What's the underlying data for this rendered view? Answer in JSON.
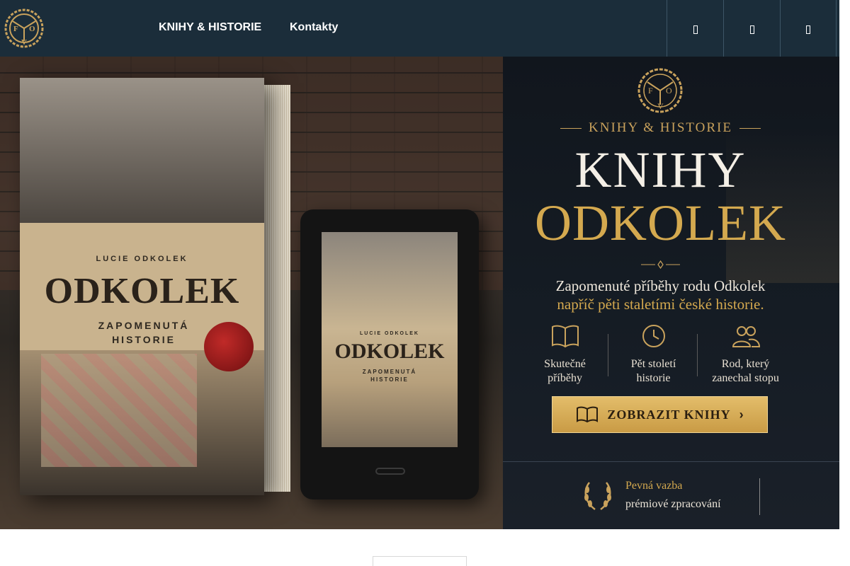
{
  "nav": {
    "logo_letters": [
      "F",
      "O",
      "V"
    ],
    "links": [
      {
        "label": "KNIHY & HISTORIE"
      },
      {
        "label": "Kontakty"
      }
    ],
    "icons": [
      "icon-1",
      "icon-2",
      "icon-3"
    ]
  },
  "hero": {
    "book": {
      "author": "LUCIE ODKOLEK",
      "title": "ODKOLEK",
      "subtitle_line1": "ZAPOMENUTÁ",
      "subtitle_line2": "HISTORIE"
    },
    "ereader": {
      "author": "LUCIE ODKOLEK",
      "title": "ODKOLEK",
      "subtitle_line1": "ZAPOMENUTÁ",
      "subtitle_line2": "HISTORIE"
    },
    "brand": "KNIHY & HISTORIE",
    "title_line1": "KNIHY",
    "title_line2": "ODKOLEK",
    "tagline_line1": "Zapomenuté příběhy rodu Odkolek",
    "tagline_line2": "napříč pěti staletími české historie.",
    "features": [
      {
        "icon": "book-icon",
        "line1": "Skutečné",
        "line2": "příběhy"
      },
      {
        "icon": "clock-icon",
        "line1": "Pět století",
        "line2": "historie"
      },
      {
        "icon": "people-icon",
        "line1": "Rod, který",
        "line2": "zanechal stopu"
      }
    ],
    "cta_label": "ZOBRAZIT KNIHY",
    "cta_arrow": "›",
    "binding_line1": "Pevná vazba",
    "binding_line2": "prémiové zpracování"
  },
  "colors": {
    "nav_bg": "#1b2d3a",
    "gold": "#d4a94f",
    "panel_bg": "#11161d"
  }
}
